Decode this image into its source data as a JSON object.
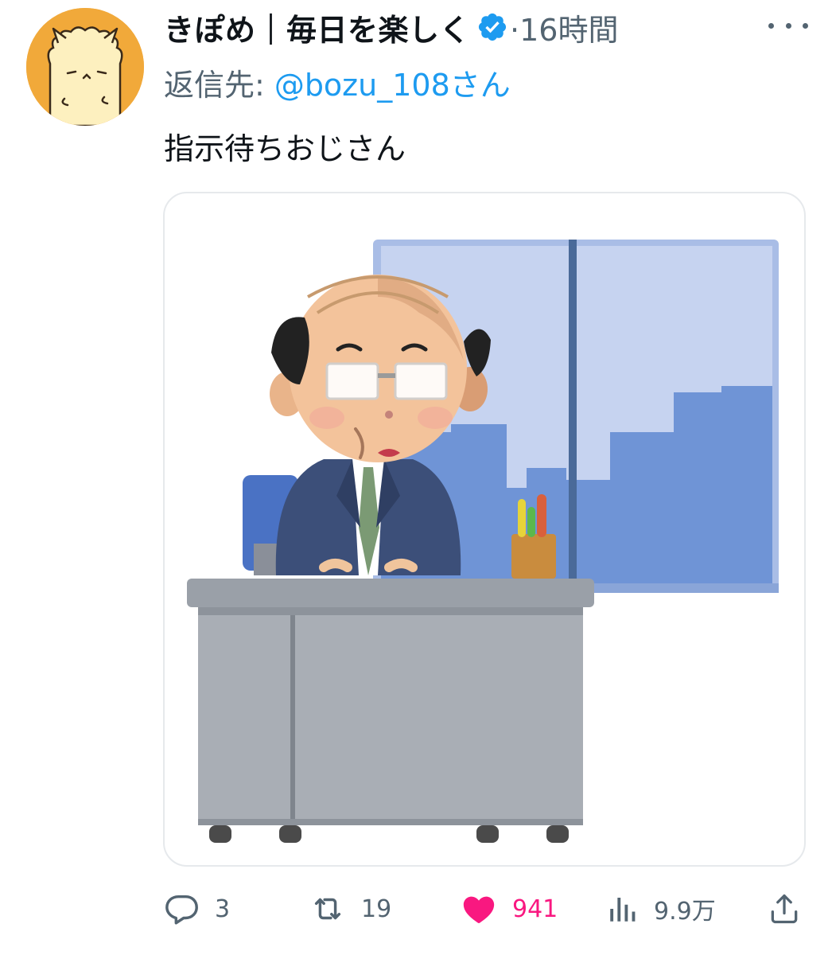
{
  "tweet": {
    "display_name": "きぽめ｜毎日を楽しく",
    "verified_icon": "verified-badge-icon",
    "separator_time": "·16時間",
    "reply_label": "返信先:",
    "reply_handle": "@bozu_108さん",
    "text": "指示待ちおじさん",
    "media_description_icon": "office-man-at-desk-illustration"
  },
  "actions": {
    "replies": "3",
    "retweets": "19",
    "likes": "941",
    "views": "9.9万"
  },
  "colors": {
    "accent": "#1d9bf0",
    "secondary_text": "#536471",
    "like": "#f91880",
    "avatar_bg": "#f1a93a"
  }
}
